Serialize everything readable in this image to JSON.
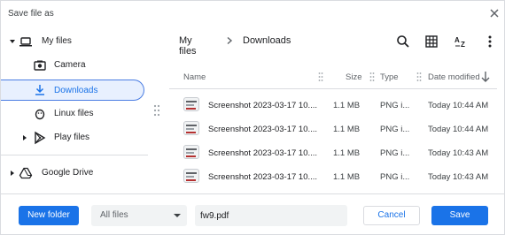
{
  "window": {
    "title": "Save file as",
    "close_icon": "close-icon"
  },
  "sidebar": {
    "root": {
      "label": "My files",
      "icon": "laptop-icon",
      "expanded": true
    },
    "items": [
      {
        "label": "Camera",
        "icon": "camera-folder-icon"
      },
      {
        "label": "Downloads",
        "icon": "download-icon",
        "selected": true
      },
      {
        "label": "Linux files",
        "icon": "linux-penguin-icon"
      },
      {
        "label": "Play files",
        "icon": "play-store-icon",
        "expandable": true
      }
    ],
    "drive": {
      "label": "Google Drive",
      "icon": "google-drive-icon",
      "expandable": true
    }
  },
  "breadcrumb": {
    "parent": "My files",
    "current": "Downloads"
  },
  "toolbar": {
    "icons": [
      "search-icon",
      "grid-view-icon",
      "sort-az-icon",
      "more-vert-icon"
    ]
  },
  "columns": {
    "name": "Name",
    "size": "Size",
    "type": "Type",
    "date": "Date modified",
    "sort": "descending"
  },
  "files": [
    {
      "name": "Screenshot 2023-03-17 10....",
      "size": "1.1 MB",
      "type": "PNG i...",
      "date": "Today 10:44 AM"
    },
    {
      "name": "Screenshot 2023-03-17 10....",
      "size": "1.1 MB",
      "type": "PNG i...",
      "date": "Today 10:44 AM"
    },
    {
      "name": "Screenshot 2023-03-17 10....",
      "size": "1.1 MB",
      "type": "PNG i...",
      "date": "Today 10:43 AM"
    },
    {
      "name": "Screenshot 2023-03-17 10....",
      "size": "1.1 MB",
      "type": "PNG i...",
      "date": "Today 10:43 AM"
    }
  ],
  "footer": {
    "new_folder": "New folder",
    "file_type": "All files",
    "filename": "fw9.pdf",
    "cancel": "Cancel",
    "save": "Save"
  },
  "colors": {
    "accent": "#1a73e8",
    "selected_bg": "#e8f0fe",
    "divider": "#dadce0"
  }
}
